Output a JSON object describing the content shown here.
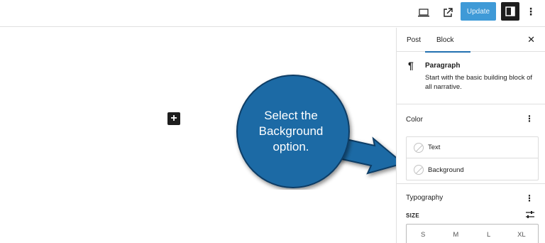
{
  "topbar": {
    "preview_icon": "desktop-icon",
    "external_icon": "external-link-icon",
    "update_label": "Update",
    "settings_icon": "sidebar-toggle-icon",
    "more_icon": "⋮"
  },
  "canvas": {
    "inserter_label": "+"
  },
  "callout": {
    "line1": "Select the",
    "line2": "Background",
    "line3": "option.",
    "color": "#1f6aa5"
  },
  "sidebar": {
    "tabs": [
      {
        "label": "Post",
        "active": false
      },
      {
        "label": "Block",
        "active": true
      }
    ],
    "close_label": "✕",
    "block": {
      "icon": "¶",
      "title": "Paragraph",
      "description": "Start with the basic building block of all narrative."
    },
    "color_panel": {
      "title": "Color",
      "more": "⋮",
      "items": [
        {
          "label": "Text"
        },
        {
          "label": "Background"
        }
      ]
    },
    "typography_panel": {
      "title": "Typography",
      "more": "⋮",
      "size_label": "SIZE",
      "sizes": [
        "S",
        "M",
        "L",
        "XL"
      ]
    }
  },
  "colors": {
    "accent": "#2271b1",
    "update_button": "#3f9ad7",
    "callout": "#1f6aa5"
  }
}
